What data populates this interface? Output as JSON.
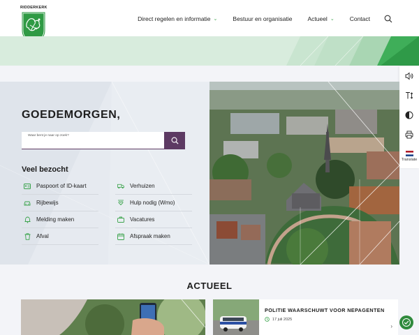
{
  "header": {
    "logo_text": "RIDDERKERK",
    "nav": [
      {
        "label": "Direct regelen en informatie",
        "has_dropdown": true
      },
      {
        "label": "Bestuur en organisatie",
        "has_dropdown": false
      },
      {
        "label": "Actueel",
        "has_dropdown": true
      },
      {
        "label": "Contact",
        "has_dropdown": false
      }
    ],
    "search_icon": "search-icon"
  },
  "tools": {
    "translate_label": "Translate"
  },
  "hero": {
    "greeting": "GOEDEMORGEN,",
    "search_placeholder": "Waar bent je naar op zoek?",
    "visited_title": "Veel bezocht",
    "links": [
      {
        "label": "Paspoort of ID-kaart",
        "icon": "id-card-icon"
      },
      {
        "label": "Verhuizen",
        "icon": "truck-icon"
      },
      {
        "label": "Rijbewijs",
        "icon": "car-icon"
      },
      {
        "label": "Hulp nodig (Wmo)",
        "icon": "helping-hand-icon"
      },
      {
        "label": "Melding maken",
        "icon": "bell-icon"
      },
      {
        "label": "Vacatures",
        "icon": "briefcase-icon"
      },
      {
        "label": "Afval",
        "icon": "trash-icon"
      },
      {
        "label": "Afspraak maken",
        "icon": "calendar-icon"
      }
    ]
  },
  "actueel": {
    "title": "ACTUEEL",
    "news": [
      {
        "title": "POLITIE WAARSCHUWT VOOR NEPAGENTEN",
        "date": "17 juli 2025"
      }
    ]
  },
  "colors": {
    "brand_green": "#3aa34b",
    "accent_purple": "#5d3a63",
    "banner_green": "#d8ecdd"
  }
}
